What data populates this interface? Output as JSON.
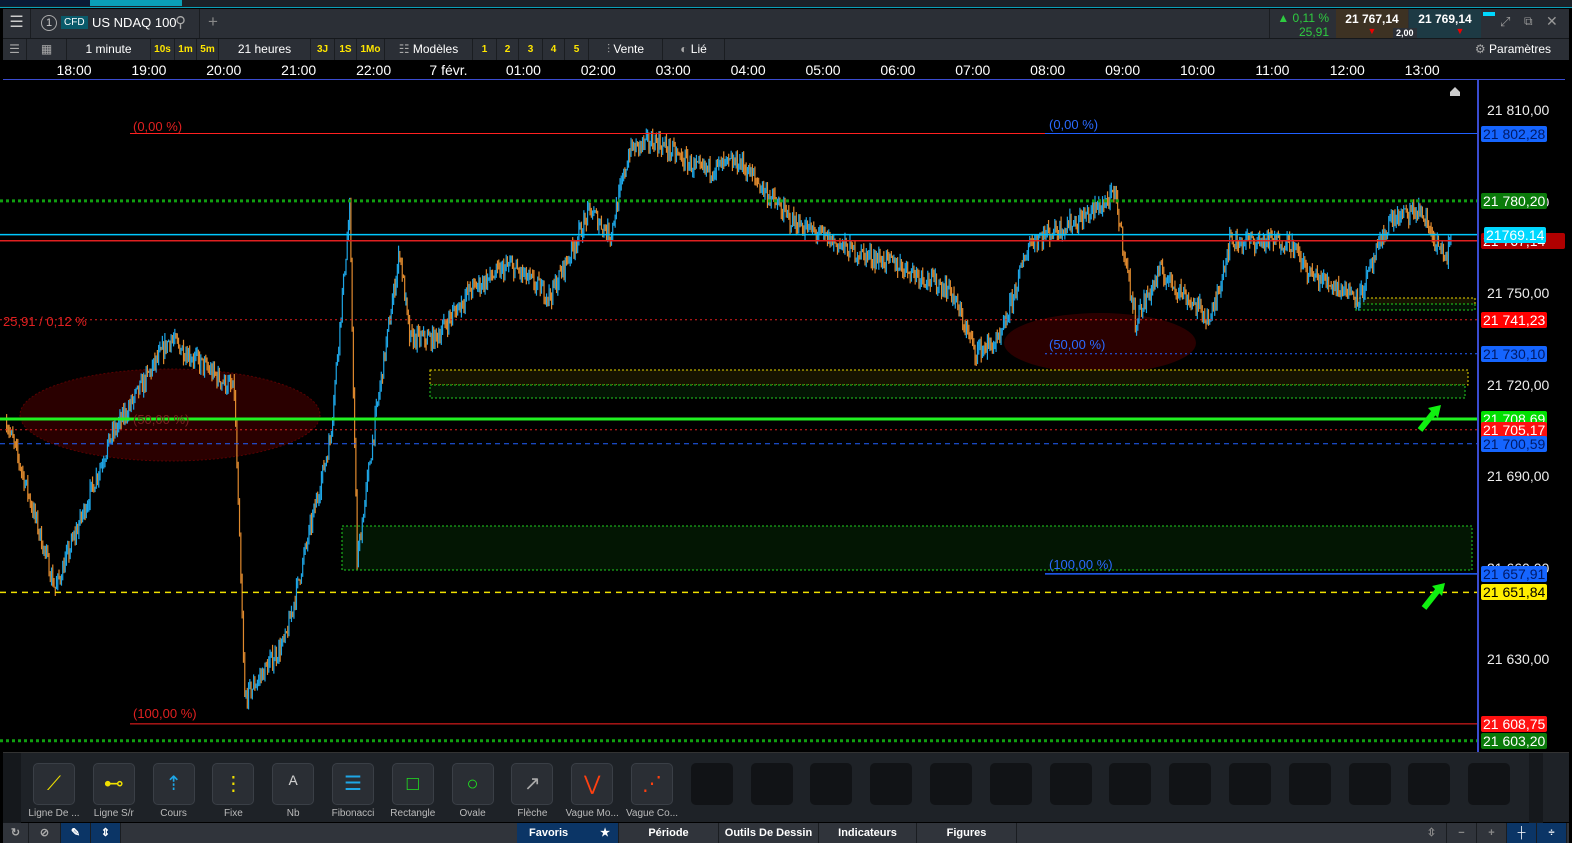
{
  "header": {
    "tab_number": "1",
    "instrument_type": "CFD",
    "instrument": "US NDAQ 100",
    "change_pct": "0,11 %",
    "change_abs": "25,91",
    "sell_price": "21 767,14",
    "buy_price": "21 769,14",
    "spread": "2,00"
  },
  "toolbar": {
    "interval": "1 minute",
    "intervals": [
      "10s",
      "1m",
      "5m"
    ],
    "range": "21 heures",
    "ranges": [
      "3J",
      "1S",
      "1Mo"
    ],
    "templates": "Modèles",
    "presets": [
      "1",
      "2",
      "3",
      "4",
      "5"
    ],
    "side": "Vente",
    "linked": "Lié",
    "settings": "Paramètres"
  },
  "time_axis": [
    "18:00",
    "19:00",
    "20:00",
    "21:00",
    "22:00",
    "7 févr.",
    "01:00",
    "02:00",
    "03:00",
    "04:00",
    "05:00",
    "06:00",
    "07:00",
    "08:00",
    "09:00",
    "10:00",
    "11:00",
    "12:00",
    "13:00"
  ],
  "price_axis": [
    "21 810,00",
    "21 780,00",
    "21 750,00",
    "21 720,00",
    "21 690,00",
    "21 660,00",
    "21 630,00"
  ],
  "price_labels": [
    {
      "text": "21 802,28",
      "bg": "#1565ff",
      "fg": "#001a66"
    },
    {
      "text": "21 780,20",
      "bg": "#0a7a0a",
      "fg": "#ffffff"
    },
    {
      "text": "21 767,14",
      "bg": "#b00000",
      "fg": "#ffffff"
    },
    {
      "text": "21769.14",
      "bg": "#00d8ff",
      "fg": "#ffffff"
    },
    {
      "text": "21 741,23",
      "bg": "#ff0000",
      "fg": "#ffffff"
    },
    {
      "text": "21 730,10",
      "bg": "#1565ff",
      "fg": "#001a66"
    },
    {
      "text": "21 708,69",
      "bg": "#00e000",
      "fg": "#ffffff"
    },
    {
      "text": "21 705,17",
      "bg": "#ff1010",
      "fg": "#ffffff"
    },
    {
      "text": "21 700,59",
      "bg": "#1565ff",
      "fg": "#001a66"
    },
    {
      "text": "21 657,91",
      "bg": "#1565ff",
      "fg": "#001a66"
    },
    {
      "text": "21 651,84",
      "bg": "#ffee00",
      "fg": "#000000"
    },
    {
      "text": "21 608,75",
      "bg": "#ff1010",
      "fg": "#ffffff"
    },
    {
      "text": "21 603,20",
      "bg": "#0a7a0a",
      "fg": "#ffffff"
    }
  ],
  "annotations": {
    "fib_red_0": "(0,00 %)",
    "fib_red_50": "(50,00 %)",
    "fib_red_100": "(100,00 %)",
    "fib_blue_0": "(0,00 %)",
    "fib_blue_50": "(50,00 %)",
    "fib_blue_100": "(100,00 %)",
    "change_note": "25,91 / 0,12 %"
  },
  "chart_data": {
    "type": "candlestick",
    "instrument": "US NDAQ 100",
    "interval": "1 minute",
    "ylim": [
      21600,
      21822
    ],
    "x_unit": "hours since 18:00",
    "path": [
      [
        -0.9,
        21708
      ],
      [
        -0.7,
        21692
      ],
      [
        -0.25,
        21653
      ],
      [
        0.48,
        21702
      ],
      [
        1.28,
        21735
      ],
      [
        2.14,
        21718
      ],
      [
        2.28,
        21617
      ],
      [
        2.82,
        21636
      ],
      [
        3.42,
        21702
      ],
      [
        3.68,
        21777
      ],
      [
        3.78,
        21662
      ],
      [
        4.02,
        21708
      ],
      [
        4.35,
        21764
      ],
      [
        4.48,
        21735
      ],
      [
        4.82,
        21735
      ],
      [
        5.29,
        21751
      ],
      [
        5.82,
        21759
      ],
      [
        6.36,
        21749
      ],
      [
        6.89,
        21777
      ],
      [
        7.16,
        21769
      ],
      [
        7.42,
        21797
      ],
      [
        7.76,
        21800
      ],
      [
        8.36,
        21790
      ],
      [
        8.89,
        21793
      ],
      [
        9.56,
        21774
      ],
      [
        10.36,
        21764
      ],
      [
        11.03,
        21759
      ],
      [
        11.7,
        21751
      ],
      [
        12.03,
        21731
      ],
      [
        12.36,
        21734
      ],
      [
        12.76,
        21767
      ],
      [
        13.43,
        21774
      ],
      [
        13.9,
        21782
      ],
      [
        14.17,
        21741
      ],
      [
        14.5,
        21757
      ],
      [
        15.18,
        21741
      ],
      [
        15.43,
        21767
      ],
      [
        16.23,
        21767
      ],
      [
        16.5,
        21756
      ],
      [
        17.17,
        21749
      ],
      [
        17.57,
        21774
      ],
      [
        17.97,
        21777
      ],
      [
        18.3,
        21761
      ],
      [
        18.4,
        21767
      ]
    ],
    "levels": [
      21802.28,
      21780.2,
      21769.14,
      21767.14,
      21741.23,
      21730.1,
      21708.69,
      21705.17,
      21700.59,
      21657.91,
      21651.84,
      21608.75,
      21603.2
    ],
    "colors": {
      "up": "#1ea6e6",
      "down": "#e08a2e"
    }
  },
  "drawing_tools": [
    "Ligne De ...",
    "Ligne S/r",
    "Cours",
    "Fixe",
    "Nb",
    "Fibonacci",
    "Rectangle",
    "Ovale",
    "Flèche",
    "Vague Mo...",
    "Vague Co..."
  ],
  "bottom_tabs": {
    "favorites": "Favoris",
    "period": "Période",
    "drawing": "Outils De Dessin",
    "indicators": "Indicateurs",
    "figures": "Figures"
  }
}
